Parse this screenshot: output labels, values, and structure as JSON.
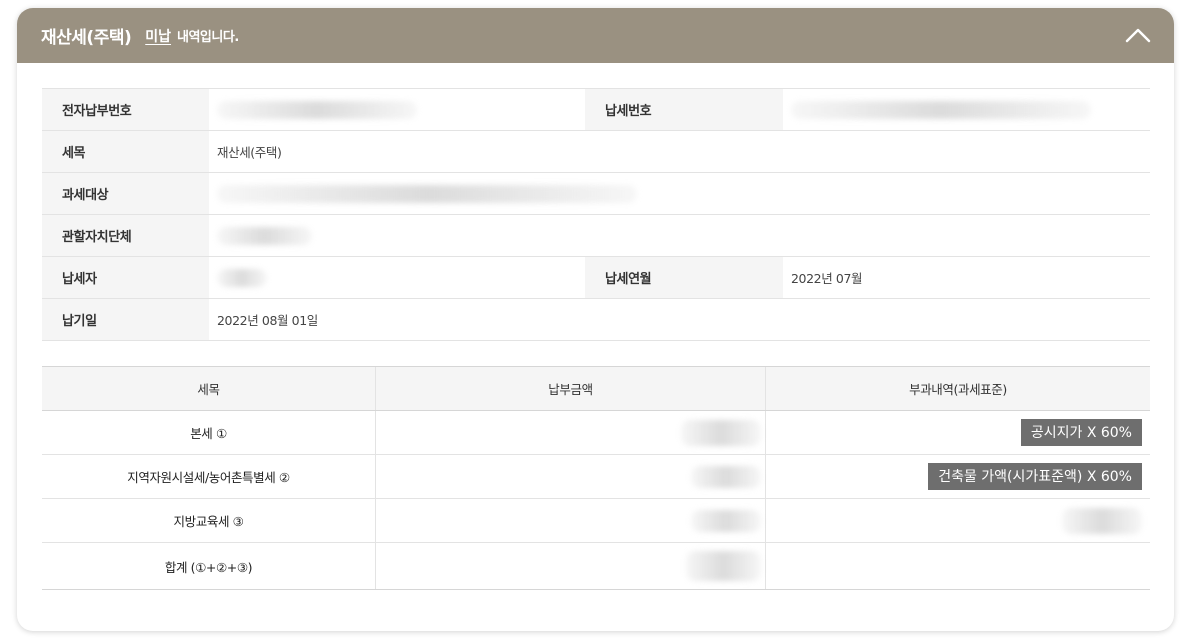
{
  "header": {
    "title": "재산세(주택)",
    "status": "미납",
    "suffix": "내역입니다."
  },
  "info": {
    "electronic_payment_no_label": "전자납부번호",
    "tax_no_label": "납세번호",
    "tax_item_label": "세목",
    "tax_item_value": "재산세(주택)",
    "tax_object_label": "과세대상",
    "local_gov_label": "관할자치단체",
    "taxpayer_label": "납세자",
    "tax_month_label": "납세연월",
    "tax_month_value": "2022년 07월",
    "due_date_label": "납기일",
    "due_date_value": "2022년 08월 01일"
  },
  "tax_table": {
    "headers": [
      "세목",
      "납부금액",
      "부과내역(과세표준)"
    ],
    "rows": [
      {
        "item": "본세 ①",
        "basis": "공시지가 X 60%"
      },
      {
        "item": "지역자원시설세/농어촌특별세 ②",
        "basis": "건축물 가액(시가표준액) X 60%"
      },
      {
        "item": "지방교육세 ③",
        "basis": ""
      },
      {
        "item": "합계 (①+②+③)",
        "basis": ""
      }
    ]
  },
  "colors": {
    "header_bg": "#9a9181",
    "label_bg": "#f5f5f5",
    "tag_bg": "#6e6e6e"
  },
  "icons": {
    "collapse": "chevron-up-icon"
  }
}
